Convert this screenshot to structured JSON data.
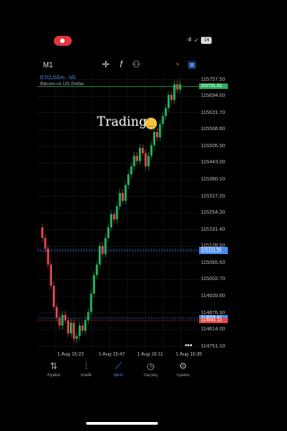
{
  "status_bar": {
    "signal": "ıll",
    "wifi": "✓",
    "battery": "14"
  },
  "toolbar": {
    "timeframe": "M1"
  },
  "chart_header": {
    "symbol": "BTCUSDm - M1",
    "description": "Bitcoin vs US Dollar"
  },
  "overlay_text": "Trading",
  "price_axis": [
    "115757.50",
    "115694.60",
    "115631.70",
    "115568.80",
    "115505.90",
    "115443.00",
    "115380.10",
    "115317.20",
    "115254.30",
    "115191.40",
    "115128.50",
    "115065.60",
    "115002.70",
    "114939.80",
    "114876.90",
    "114814.00",
    "114751.10"
  ],
  "price_tags": {
    "current": "115731.53",
    "level1": "115116.56",
    "level2": "115110.28",
    "level3": "114858.47",
    "level4": "114849.13"
  },
  "time_axis": [
    "1 Aug 15:23",
    "1 Aug 15:47",
    "1 Aug 16:11",
    "1 Aug 16:35"
  ],
  "nav": {
    "items": [
      {
        "label": "Fiyatlar",
        "icon": "price-icon"
      },
      {
        "label": "Grafik",
        "icon": "chart-icon"
      },
      {
        "label": "İşlem",
        "icon": "trade-icon"
      },
      {
        "label": "Geçmiş",
        "icon": "history-icon"
      },
      {
        "label": "Ayarlar",
        "icon": "settings-icon"
      }
    ],
    "active": "İşlem"
  },
  "colors": {
    "up": "#25b35d",
    "down": "#e1474a",
    "accent": "#4b8cf0"
  }
}
